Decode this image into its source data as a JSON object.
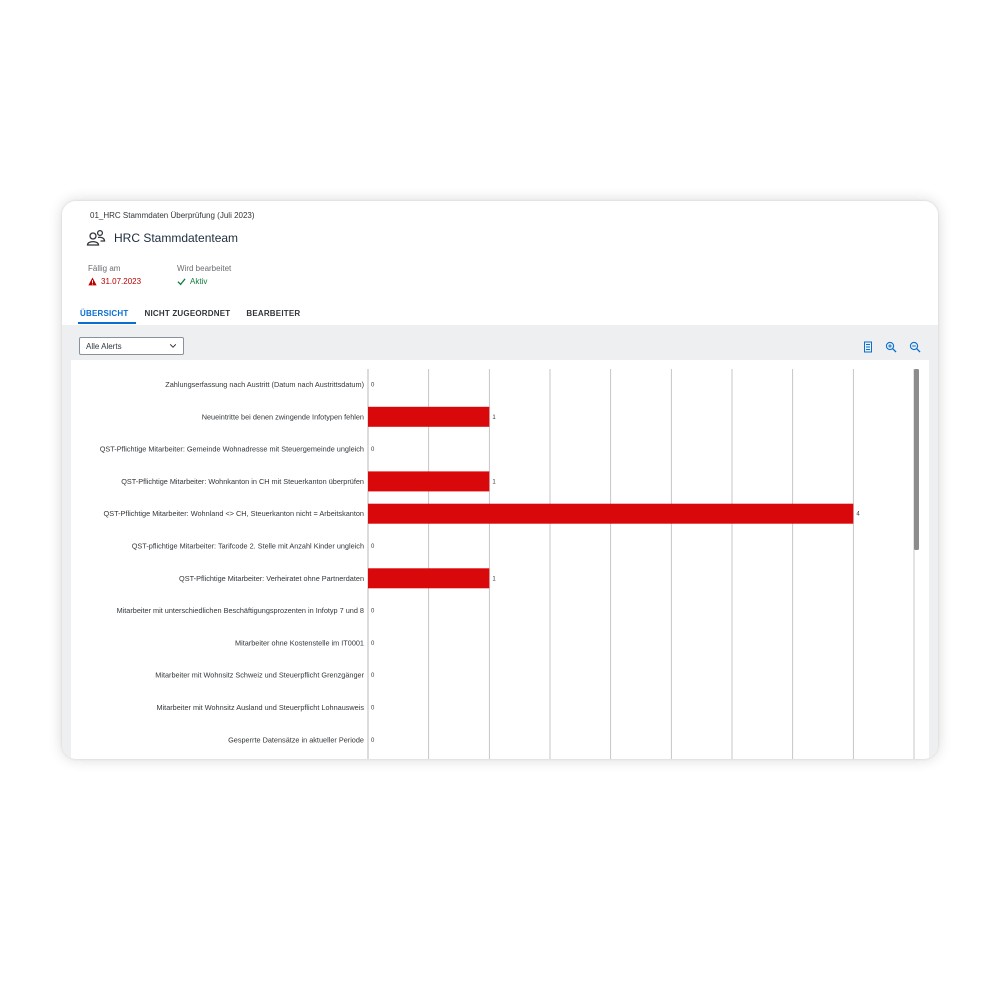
{
  "header": {
    "breadcrumb": "01_HRC Stammdaten Überprüfung (Juli 2023)",
    "title": "HRC Stammdatenteam",
    "due_label": "Fällig am",
    "due_value": "31.07.2023",
    "status_label": "Wird bearbeitet",
    "status_value": "Aktiv"
  },
  "tabs": [
    {
      "label": "ÜBERSICHT",
      "active": true
    },
    {
      "label": "NICHT ZUGEORDNET",
      "active": false
    },
    {
      "label": "BEARBEITER",
      "active": false
    }
  ],
  "filter": {
    "selected": "Alle Alerts"
  },
  "icons": {
    "title": "people-group-icon",
    "due": "warning-triangle-icon",
    "status": "checkmark-icon",
    "toolbar": [
      "legend-icon",
      "zoom-in-icon",
      "zoom-out-icon"
    ]
  },
  "colors": {
    "bar": "#d9080b",
    "accent": "#0a6ed1",
    "negative": "#bb0000",
    "positive": "#107e3e"
  },
  "chart_data": {
    "type": "bar",
    "orientation": "horizontal",
    "categories": [
      "Zahlungserfassung nach Austritt (Datum nach Austrittsdatum)",
      "Neueintritte bei denen zwingende Infotypen fehlen",
      "QST-Pflichtige Mitarbeiter: Gemeinde Wohnadresse mit Steuergemeinde ungleich",
      "QST-Pflichtige Mitarbeiter: Wohnkanton in CH mit Steuerkanton überprüfen",
      "QST-Pflichtige Mitarbeiter: Wohnland <> CH, Steuerkanton nicht = Arbeitskanton",
      "QST-pflichtige Mitarbeiter: Tarifcode 2. Stelle mit Anzahl Kinder ungleich",
      "QST-Pflichtige Mitarbeiter: Verheiratet ohne Partnerdaten",
      "Mitarbeiter mit unterschiedlichen Beschäftigungsprozenten in Infotyp 7 und 8",
      "Mitarbeiter ohne Kostenstelle im IT0001",
      "Mitarbeiter mit Wohnsitz Schweiz und Steuerpflicht Grenzgänger",
      "Mitarbeiter mit Wohnsitz Ausland und Steuerpflicht Lohnausweis",
      "Gesperrte Datensätze in aktueller Periode"
    ],
    "values": [
      0,
      1,
      0,
      1,
      4,
      0,
      1,
      0,
      0,
      0,
      0,
      0
    ],
    "data_labels": [
      "0",
      "1",
      "0",
      "1",
      "4",
      "0",
      "1",
      "0",
      "0",
      "0",
      "0",
      "0"
    ],
    "xlim": [
      0,
      4.5
    ],
    "grid": true,
    "grid_step": 0.5
  }
}
